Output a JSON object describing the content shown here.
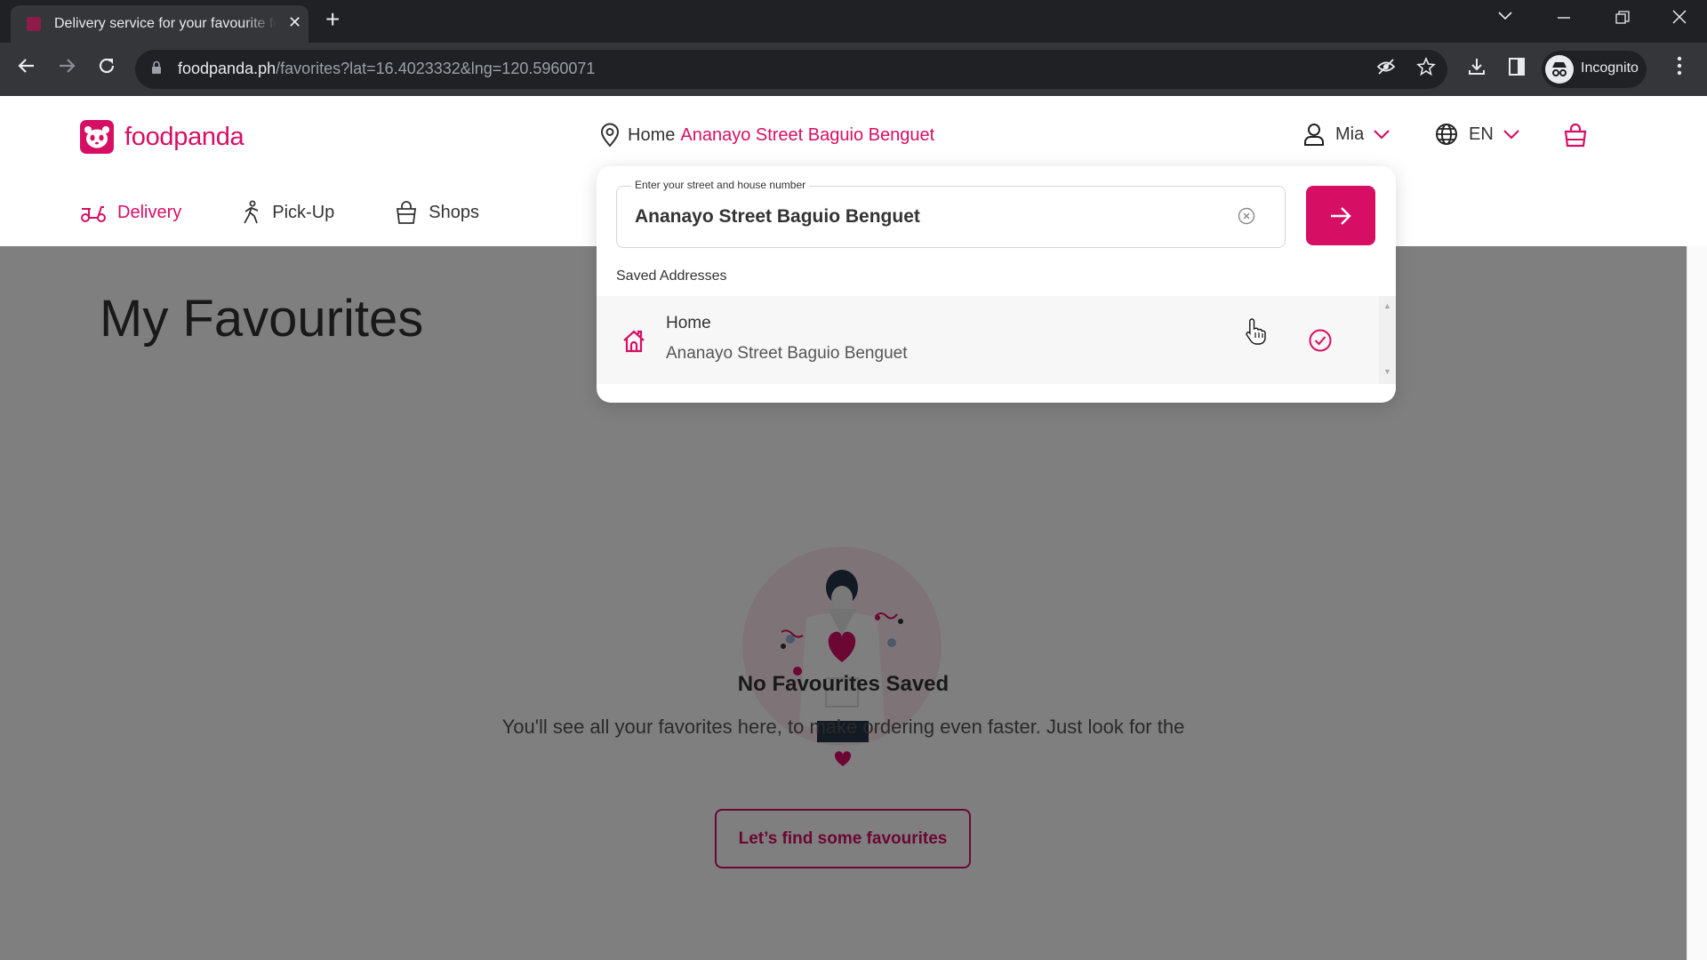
{
  "browser": {
    "tab_title": "Delivery service for your favourite food",
    "url_host": "foodpanda.ph",
    "url_path": "/favorites?lat=16.4023332&lng=120.5960071",
    "profile_label": "Incognito"
  },
  "header": {
    "logo_text": "foodpanda",
    "location_label": "Home",
    "location_address": "Ananayo Street Baguio Benguet",
    "user_name": "Mia",
    "language": "EN",
    "nav_tabs": [
      {
        "label": "Delivery",
        "icon": "scooter-icon",
        "active": true
      },
      {
        "label": "Pick-Up",
        "icon": "walking-person-icon",
        "active": false
      },
      {
        "label": "Shops",
        "icon": "shopping-bag-icon",
        "active": false
      }
    ]
  },
  "address_dropdown": {
    "field_label": "Enter your street and house number",
    "field_value": "Ananayo Street Baguio Benguet",
    "saved_label": "Saved Addresses",
    "saved_addresses": [
      {
        "name": "Home",
        "address": "Ananayo Street Baguio Benguet",
        "selected": true
      }
    ]
  },
  "main": {
    "title": "My Favourites",
    "empty_title": "No Favourites Saved",
    "empty_text": "You'll see all your favorites here, to make ordering even faster. Just look for the",
    "cta_label": "Let’s find some favourites"
  },
  "colors": {
    "brand": "#d70f64"
  }
}
